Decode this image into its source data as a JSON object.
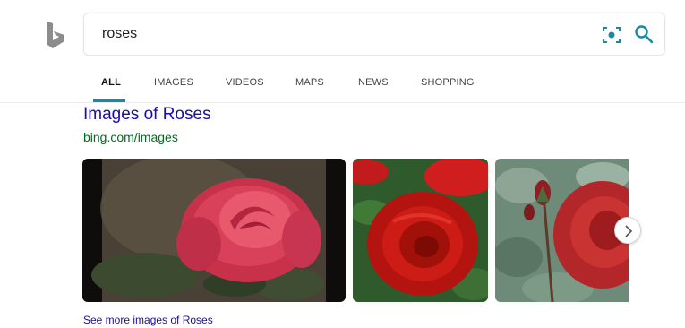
{
  "search": {
    "query": "roses"
  },
  "tabs": [
    "ALL",
    "IMAGES",
    "VIDEOS",
    "MAPS",
    "NEWS",
    "SHOPPING"
  ],
  "active_tab": "ALL",
  "result": {
    "title": "Images of Roses",
    "url": "bing.com/images",
    "see_more": "See more images of Roses"
  },
  "colors": {
    "accent": "#1a8aa3",
    "link": "#1a0dab",
    "url_green": "#006d21"
  },
  "icons": [
    "bing-logo",
    "visual-search-icon",
    "search-icon",
    "chevron-right-icon"
  ]
}
